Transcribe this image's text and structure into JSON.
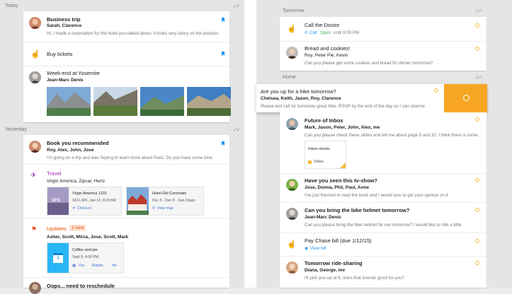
{
  "sections": {
    "today": "Today",
    "yesterday": "Yesterday",
    "tomorrow": "Tomorrow",
    "home": "Home"
  },
  "left": {
    "business_trip": {
      "title": "Business trip",
      "people": "Sarah, Clarence",
      "snippet": "Hi, I made a reservation for the hotel you talked about. It looks very fancy on the pictures"
    },
    "buy_tickets": {
      "title": "Buy tickets"
    },
    "yosemite": {
      "title": "Week-end at Yosemite",
      "people": "Jean-Marc Denis"
    },
    "book": {
      "title": "Book you recommended",
      "people": "Roy, Alex, John, Jose",
      "snippet": "I'm going on a trip and was hoping to learn more about Paris. Do you have some time"
    },
    "travel": {
      "label": "Travel",
      "people": "Virgin America, Zipcar, Hertz",
      "flight": {
        "title": "Virgin America 1231",
        "route": "SFO-JFK, Jan 13, 8:23 AM",
        "action": "Check in",
        "code": "SFO"
      },
      "hotel": {
        "title": "Hotel Del Coronado",
        "dates": "Dec 5 - Dec 8 · San Diego",
        "action": "View map"
      }
    },
    "updates": {
      "label": "Updates",
      "badge": "1 new",
      "people": "Asher, Scott, Mirza, Jose, Scott, Mark",
      "event": {
        "title": "Coffee and pie",
        "time": "Sept 9, 4:00 PM",
        "yes": "Yes",
        "maybe": "Maybe",
        "no": "No",
        "day": "9"
      }
    },
    "oops": {
      "title": "Oops... need to reschedule"
    }
  },
  "right": {
    "call_doctor": {
      "title": "Call the Doctor",
      "call": "Call",
      "open": "Open",
      "hours": "until 8:00 PM"
    },
    "bread": {
      "title": "Bread and cookies!",
      "people": "Roy, Peter Pie, Kevin",
      "snippet": "Can you please get some cookies and bread for dinner tomorrow?"
    },
    "hike": {
      "title": "Are you up for a hike tomorrow?",
      "people": "Chelsea, Keith, Jason, Roy, Clarence",
      "snippet": "Please last call for tomorrow great hike. RSVP by the end of the day so I can reserve"
    },
    "inbox": {
      "title": "Future of Inbox",
      "people": "Mark, Jason, Peter, John, Alex, me",
      "snippet": "Can you please check these slides and tell me about page 5 and 32. I think there is some",
      "doc": "Inbox mocks",
      "doc_type": "Slides"
    },
    "tvshow": {
      "title": "Have you seen this tv-show?",
      "people": "Jose, Donna, Phil, Paul, Anne",
      "snippet": "I've just finished to read the book and I would love to get your opinion on it"
    },
    "helmet": {
      "title": "Can you bring the bike helmet tomorrow?",
      "people": "Jean-Marc Denis",
      "snippet": "Can you please bring the bike helmet for me tomorrow? I would like to ride a little"
    },
    "chase": {
      "title": "Pay Chase bill (due 1/12/15)",
      "action": "View bill"
    },
    "ride": {
      "title": "Tomorrow ride-sharing",
      "people": "Diana, George, me",
      "snippet": "I'll pick you up at 8, does that sounds good for you?"
    }
  }
}
